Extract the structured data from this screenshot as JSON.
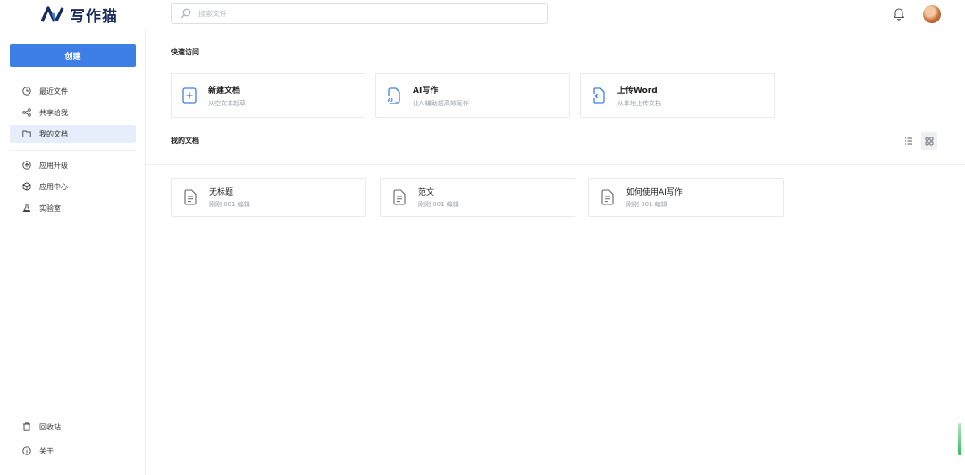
{
  "header": {
    "logo_text": "写作猫",
    "search_placeholder": "搜索文件"
  },
  "sidebar": {
    "create_label": "创建",
    "items": [
      {
        "label": "最近文件",
        "icon": "clock-icon"
      },
      {
        "label": "共享给我",
        "icon": "share-icon"
      },
      {
        "label": "我的文档",
        "icon": "folder-icon",
        "active": true
      },
      {
        "label": "应用升级",
        "icon": "upgrade-icon"
      },
      {
        "label": "应用中心",
        "icon": "cube-icon"
      },
      {
        "label": "实验室",
        "icon": "flask-icon"
      }
    ],
    "bottom_items": [
      {
        "label": "回收站",
        "icon": "trash-icon"
      },
      {
        "label": "关于",
        "icon": "info-icon"
      }
    ]
  },
  "quick_access": {
    "title": "快速访问",
    "cards": [
      {
        "title": "新建文档",
        "subtitle": "从空文本起草",
        "icon": "new-doc-icon"
      },
      {
        "title": "AI写作",
        "subtitle": "让AI辅助您高效写作",
        "icon": "ai-doc-icon"
      },
      {
        "title": "上传Word",
        "subtitle": "从本地上传文档",
        "icon": "upload-doc-icon"
      }
    ]
  },
  "my_docs": {
    "title": "我的文档",
    "view_mode": "grid",
    "docs": [
      {
        "title": "无标题",
        "meta": "刚刚 001 编辑"
      },
      {
        "title": "范文",
        "meta": "刚刚 001 编辑"
      },
      {
        "title": "如何使用AI写作",
        "meta": "刚刚 001 编辑"
      }
    ]
  },
  "colors": {
    "accent": "#3d7fe6",
    "active_bg": "#e6eefb",
    "logo": "#1a2b5f"
  }
}
